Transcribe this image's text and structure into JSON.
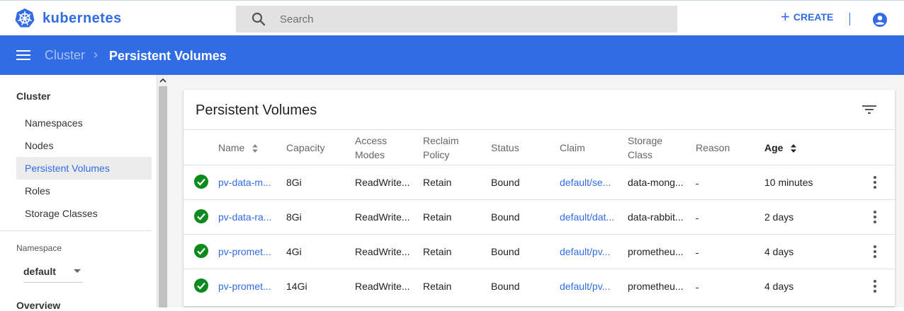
{
  "brand": {
    "name": "kubernetes"
  },
  "search": {
    "placeholder": "Search"
  },
  "header": {
    "create_label": "CREATE"
  },
  "breadcrumb": {
    "root": "Cluster",
    "separator": "›",
    "current": "Persistent Volumes"
  },
  "sidebar": {
    "heading": "Cluster",
    "items": [
      {
        "label": "Namespaces",
        "active": false
      },
      {
        "label": "Nodes",
        "active": false
      },
      {
        "label": "Persistent Volumes",
        "active": true
      },
      {
        "label": "Roles",
        "active": false
      },
      {
        "label": "Storage Classes",
        "active": false
      }
    ],
    "namespace_label": "Namespace",
    "namespace_value": "default",
    "overview_label": "Overview"
  },
  "card": {
    "title": "Persistent Volumes"
  },
  "table": {
    "columns": {
      "name": "Name",
      "capacity": "Capacity",
      "access_modes_1": "Access",
      "access_modes_2": "Modes",
      "reclaim_1": "Reclaim",
      "reclaim_2": "Policy",
      "status": "Status",
      "claim": "Claim",
      "storage_1": "Storage",
      "storage_2": "Class",
      "reason": "Reason",
      "age": "Age"
    },
    "rows": [
      {
        "name": "pv-data-m...",
        "capacity": "8Gi",
        "access_modes": "ReadWrite...",
        "reclaim": "Retain",
        "status": "Bound",
        "claim": "default/se...",
        "storage_class": "data-mong...",
        "reason": "-",
        "age": "10 minutes"
      },
      {
        "name": "pv-data-ra...",
        "capacity": "8Gi",
        "access_modes": "ReadWrite...",
        "reclaim": "Retain",
        "status": "Bound",
        "claim": "default/dat...",
        "storage_class": "data-rabbit...",
        "reason": "-",
        "age": "2 days"
      },
      {
        "name": "pv-promet...",
        "capacity": "4Gi",
        "access_modes": "ReadWrite...",
        "reclaim": "Retain",
        "status": "Bound",
        "claim": "default/pv...",
        "storage_class": "prometheu...",
        "reason": "-",
        "age": "4 days"
      },
      {
        "name": "pv-promet...",
        "capacity": "14Gi",
        "access_modes": "ReadWrite...",
        "reclaim": "Retain",
        "status": "Bound",
        "claim": "default/pv...",
        "storage_class": "prometheu...",
        "reason": "-",
        "age": "4 days"
      }
    ]
  },
  "colors": {
    "accent": "#326ce5",
    "ok": "#0c8a1d"
  }
}
